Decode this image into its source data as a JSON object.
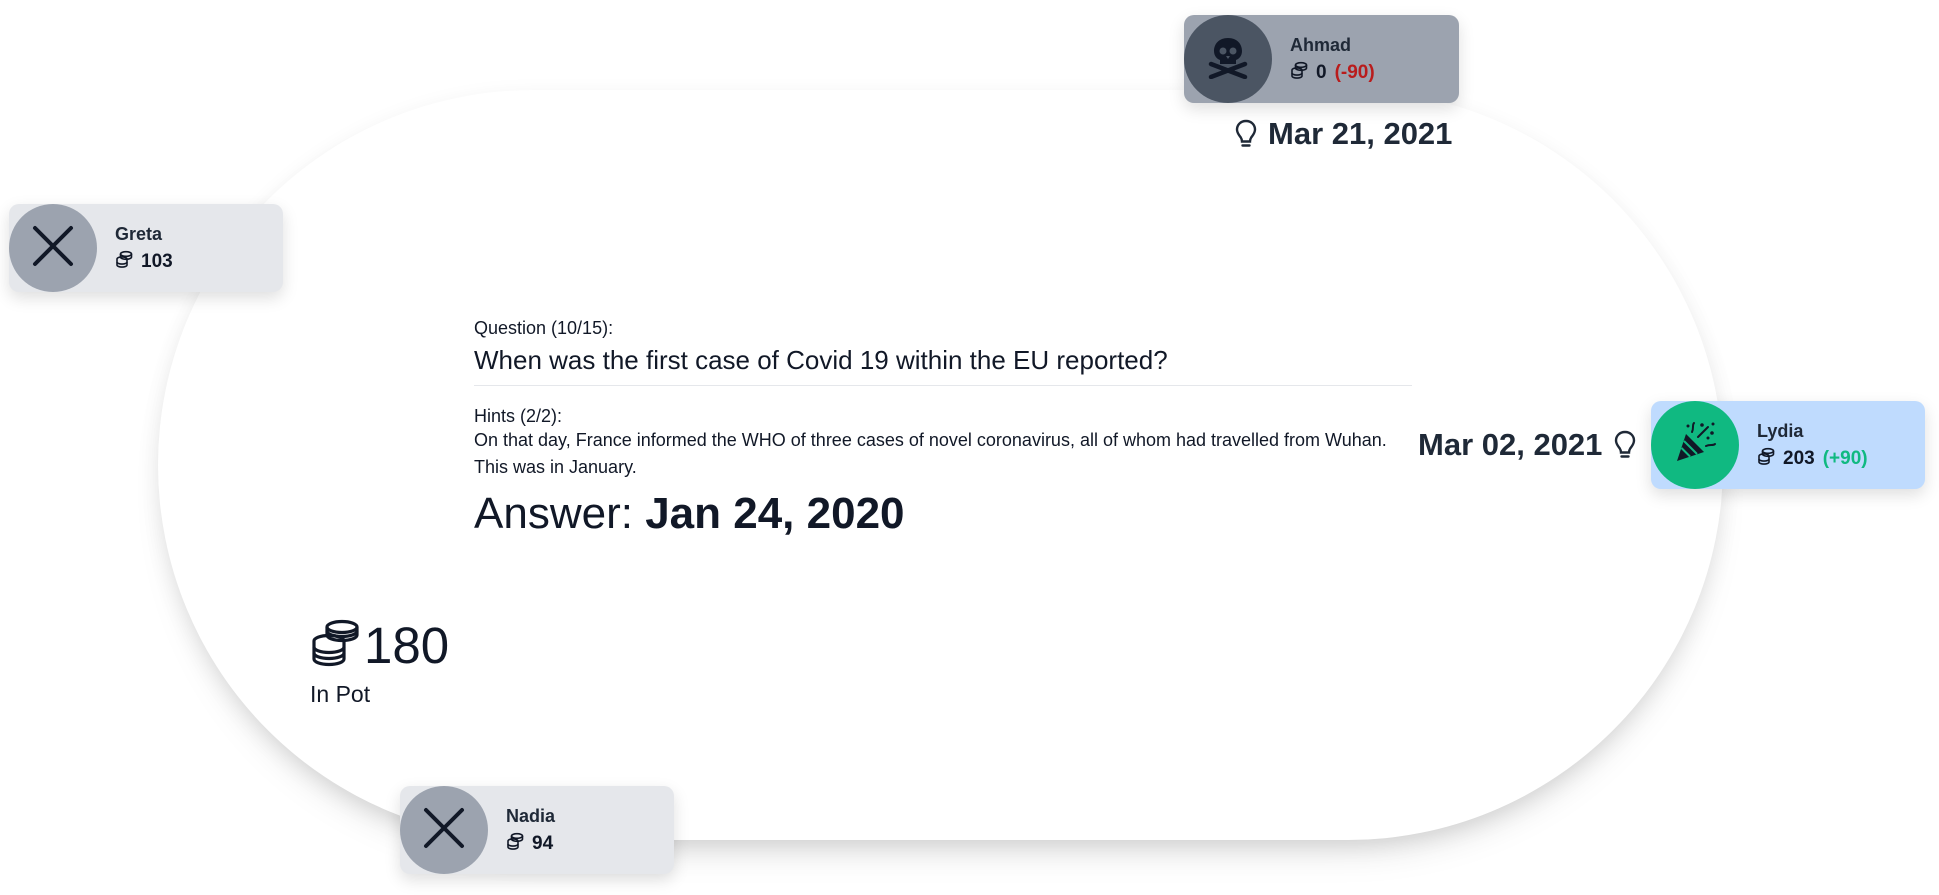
{
  "players": {
    "ahmad": {
      "name": "Ahmad",
      "coins": "0",
      "delta": "(-90)",
      "avatar_icon": "skull-crossbones-icon"
    },
    "greta": {
      "name": "Greta",
      "coins": "103",
      "avatar_icon": "close-icon"
    },
    "lydia": {
      "name": "Lydia",
      "coins": "203",
      "delta": "(+90)",
      "avatar_icon": "party-popper-icon"
    },
    "nadia": {
      "name": "Nadia",
      "coins": "94",
      "avatar_icon": "close-icon"
    }
  },
  "guesses": {
    "ahmad": "Mar 21, 2021",
    "lydia": "Mar 02, 2021"
  },
  "question": {
    "label": "Question (10/15):",
    "text": "When was the first case of Covid 19 within the EU reported?"
  },
  "hints": {
    "label": "Hints (2/2):",
    "items": [
      "On that day, France informed the WHO of three cases of novel coronavirus, all of whom had travelled from Wuhan.",
      "This was in January."
    ]
  },
  "answer": {
    "prefix": "Answer:",
    "value": "Jan 24, 2020"
  },
  "pot": {
    "amount": "180",
    "label": "In Pot"
  },
  "colors": {
    "negative_delta": "#b91c1c",
    "positive_delta": "#10b981",
    "winner_avatar": "#10b981",
    "winner_card": "#bfdbfe",
    "loser_avatar": "#4b5563",
    "loser_card": "#9ca3af",
    "folded_avatar": "#9ca3af",
    "folded_card": "#e5e7eb"
  }
}
